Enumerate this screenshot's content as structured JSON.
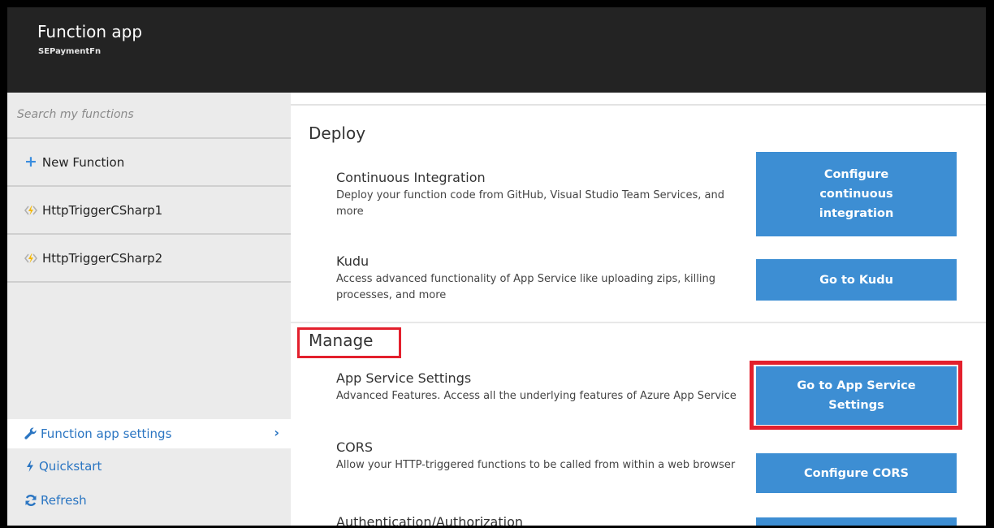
{
  "header": {
    "title": "Function app",
    "subtitle": "SEPaymentFn"
  },
  "sidebar": {
    "search_placeholder": "Search my functions",
    "new_function": "New Function",
    "functions": [
      "HttpTriggerCSharp1",
      "HttpTriggerCSharp2"
    ],
    "bottom": {
      "settings": "Function app settings",
      "quickstart": "Quickstart",
      "refresh": "Refresh"
    }
  },
  "main": {
    "deploy": {
      "title": "Deploy",
      "ci": {
        "title": "Continuous Integration",
        "desc": "Deploy your function code from GitHub, Visual Studio Team Services, and more",
        "button": [
          "Configure",
          "continuous",
          "integration"
        ]
      },
      "kudu": {
        "title": "Kudu",
        "desc": "Access advanced functionality of App Service like uploading zips, killing processes, and more",
        "button": "Go to Kudu"
      }
    },
    "manage": {
      "title": "Manage",
      "app_service": {
        "title": "App Service Settings",
        "desc": "Advanced Features. Access all the underlying features of Azure App Service",
        "button": [
          "Go to App Service",
          "Settings"
        ]
      },
      "cors": {
        "title": "CORS",
        "desc": "Allow your HTTP-triggered functions to be called from within a web browser",
        "button": "Configure CORS"
      },
      "auth": {
        "title": "Authentication/Authorization"
      }
    }
  },
  "colors": {
    "accent": "#3d8ed3",
    "highlight": "#e3202d",
    "header_bg": "#232323",
    "sidebar_bg": "#ebebeb"
  },
  "icons": {
    "new_function": "plus-icon",
    "function": "lightning-bracket-icon",
    "settings": "wrench-icon",
    "quickstart": "lightning-icon",
    "refresh": "refresh-icon",
    "chevron": "chevron-right-icon"
  }
}
